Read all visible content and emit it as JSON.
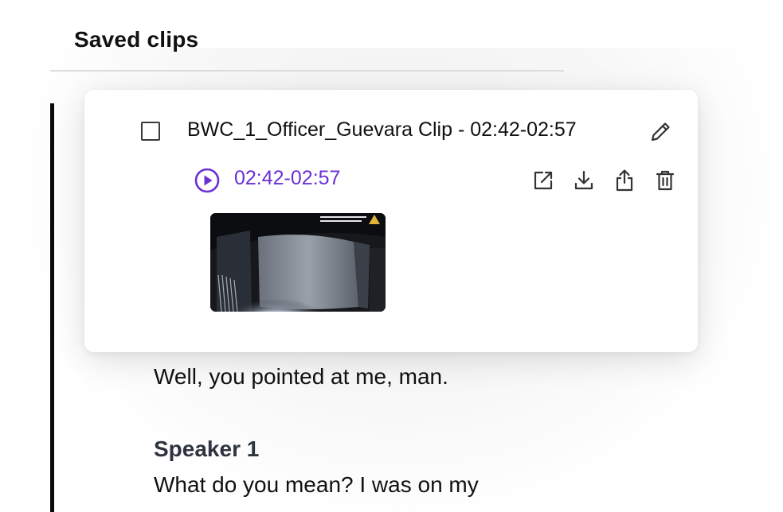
{
  "header": {
    "title": "Saved clips"
  },
  "clip": {
    "title": "BWC_1_Officer_Guevara Clip - 02:42-02:57",
    "range": "02:42-02:57",
    "checked": false,
    "icons": {
      "edit": "pencil-icon",
      "play": "play-circle-icon",
      "open": "open-external-icon",
      "download": "download-icon",
      "share": "share-icon",
      "delete": "trash-icon"
    },
    "accent_color": "#6b2fd6"
  },
  "transcript": {
    "line1": "Well, you pointed at me, man.",
    "speaker": "Speaker 1",
    "line2": "What do you mean? I was on my"
  }
}
